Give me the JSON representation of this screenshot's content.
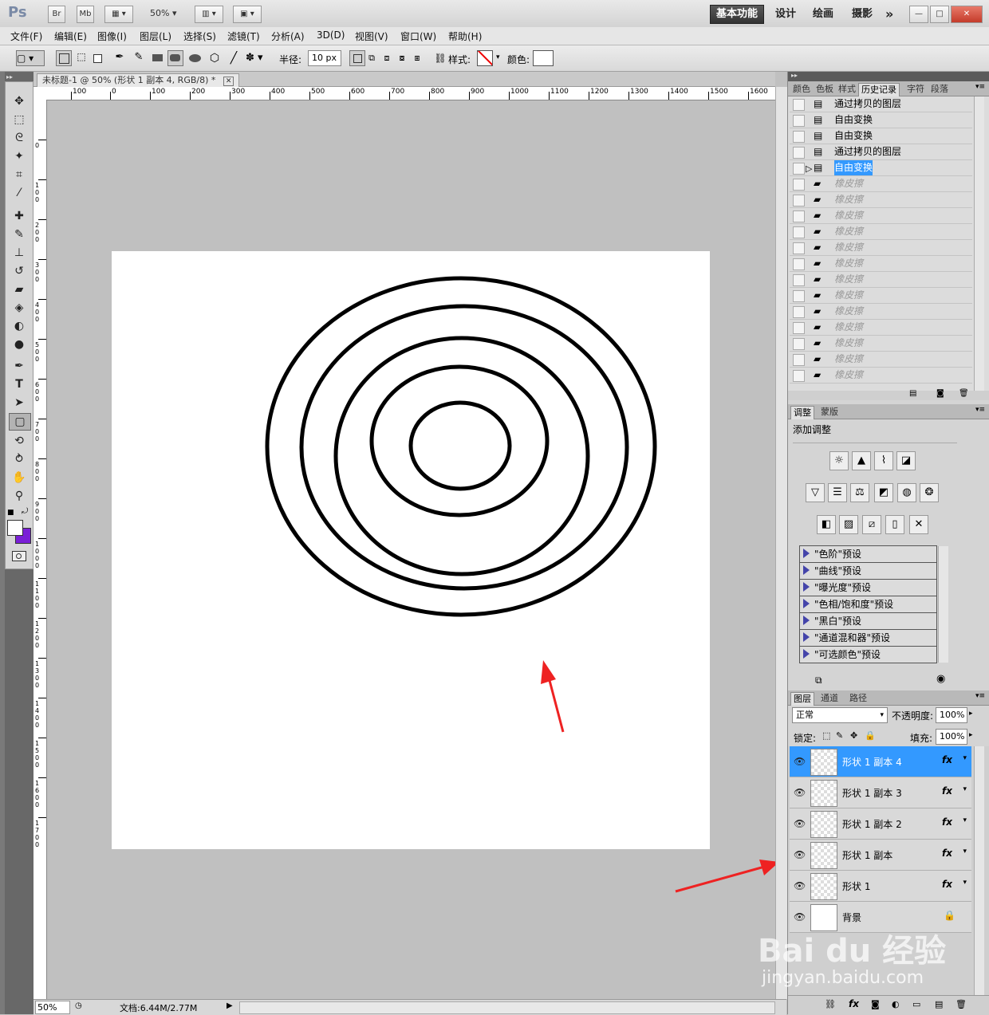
{
  "app": {
    "logo": "Ps",
    "bridge_btn": "Br",
    "minibridge_btn": "Mb",
    "zoom_select": "50%",
    "workspaces": [
      "基本功能",
      "设计",
      "绘画",
      "摄影"
    ],
    "more": "»"
  },
  "menu": [
    "文件(F)",
    "编辑(E)",
    "图像(I)",
    "图层(L)",
    "选择(S)",
    "滤镜(T)",
    "分析(A)",
    "3D(D)",
    "视图(V)",
    "窗口(W)",
    "帮助(H)"
  ],
  "options": {
    "radius_label": "半径:",
    "radius_value": "10 px",
    "style_label": "样式:",
    "color_label": "颜色:"
  },
  "document": {
    "tab_title": "未标题-1 @ 50% (形状 1 副本 4, RGB/8) *",
    "zoom": "50%",
    "doc_info": "文档:6.44M/2.77M",
    "h_ruler": [
      "100",
      "0",
      "100",
      "200",
      "300",
      "400",
      "500",
      "600",
      "700",
      "800",
      "900",
      "1000",
      "1100",
      "1200",
      "1300",
      "1400",
      "1500",
      "1600"
    ],
    "v_ruler": [
      "0",
      "100",
      "200",
      "300",
      "400",
      "500",
      "600",
      "700",
      "800",
      "900",
      "1000",
      "1100",
      "1200",
      "1300",
      "1400",
      "1500",
      "1600",
      "1700"
    ]
  },
  "history_panel": {
    "tabs": [
      "颜色",
      "色板",
      "样式",
      "历史记录",
      "字符",
      "段落"
    ],
    "active_tab": "历史记录",
    "items": [
      {
        "label": "通过拷贝的图层",
        "state": "normal"
      },
      {
        "label": "自由变换",
        "state": "normal"
      },
      {
        "label": "自由变换",
        "state": "normal"
      },
      {
        "label": "通过拷贝的图层",
        "state": "normal"
      },
      {
        "label": "自由变换",
        "state": "selected"
      },
      {
        "label": "橡皮擦",
        "state": "gray"
      },
      {
        "label": "橡皮擦",
        "state": "gray"
      },
      {
        "label": "橡皮擦",
        "state": "gray"
      },
      {
        "label": "橡皮擦",
        "state": "gray"
      },
      {
        "label": "橡皮擦",
        "state": "gray"
      },
      {
        "label": "橡皮擦",
        "state": "gray"
      },
      {
        "label": "橡皮擦",
        "state": "gray"
      },
      {
        "label": "橡皮擦",
        "state": "gray"
      },
      {
        "label": "橡皮擦",
        "state": "gray"
      },
      {
        "label": "橡皮擦",
        "state": "gray"
      },
      {
        "label": "橡皮擦",
        "state": "gray"
      },
      {
        "label": "橡皮擦",
        "state": "gray"
      },
      {
        "label": "橡皮擦",
        "state": "gray"
      }
    ]
  },
  "adjust_panel": {
    "tabs": [
      "调整",
      "蒙版"
    ],
    "active_tab": "调整",
    "title": "添加调整",
    "presets": [
      "\"色阶\"预设",
      "\"曲线\"预设",
      "\"曝光度\"预设",
      "\"色相/饱和度\"预设",
      "\"黑白\"预设",
      "\"通道混和器\"预设",
      "\"可选颜色\"预设"
    ]
  },
  "layers_panel": {
    "tabs": [
      "图层",
      "通道",
      "路径"
    ],
    "active_tab": "图层",
    "blend_mode": "正常",
    "opacity_label": "不透明度:",
    "opacity_value": "100%",
    "lock_label": "锁定:",
    "fill_label": "填充:",
    "fill_value": "100%",
    "fx_label": "fx",
    "layers": [
      {
        "name": "形状 1 副本 4",
        "selected": true
      },
      {
        "name": "形状 1 副本 3",
        "selected": false
      },
      {
        "name": "形状 1 副本 2",
        "selected": false
      },
      {
        "name": "形状 1 副本",
        "selected": false
      },
      {
        "name": "形状 1",
        "selected": false
      },
      {
        "name": "背景",
        "selected": false
      }
    ]
  },
  "watermark": {
    "brand": "Bai du 经验",
    "url": "jingyan.baidu.com"
  },
  "colors": {
    "selection": "#3399ff",
    "annotation_arrow": "#ee2222",
    "background_swatch": "#7a1fd6"
  }
}
